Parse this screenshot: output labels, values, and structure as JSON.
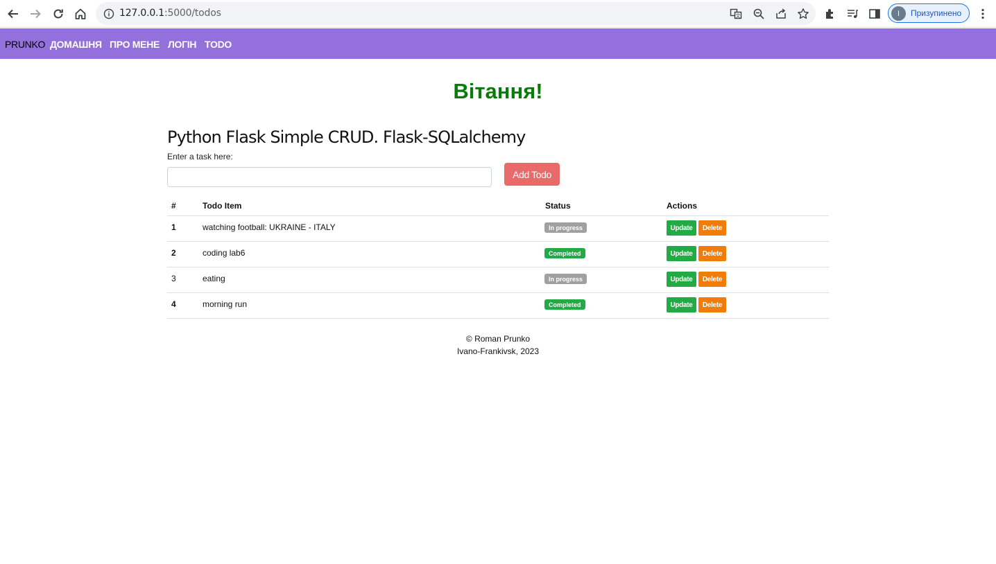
{
  "browser": {
    "url_host": "127.0.0.1",
    "url_path": ":5000/todos",
    "profile_initial": "I",
    "profile_label": "Призупинено"
  },
  "navbar": {
    "brand": "PRUNKO",
    "links": [
      "ДОМАШНЯ",
      "ПРО МЕНЕ",
      "ЛОГІН",
      "TODO"
    ],
    "bg_color": "#9370db"
  },
  "greeting": "Вітання!",
  "heading": "Python Flask Simple CRUD. Flask-SQLalchemy",
  "form": {
    "label": "Enter a task here:",
    "input_value": "",
    "add_button": "Add Todo"
  },
  "table": {
    "headers": [
      "#",
      "Todo Item",
      "Status",
      "Actions"
    ],
    "rows": [
      {
        "num": "1",
        "item": "watching football: UKRAINE - ITALY",
        "status": "In progress",
        "status_type": "progress"
      },
      {
        "num": "2",
        "item": "coding lab6",
        "status": "Completed",
        "status_type": "completed"
      },
      {
        "num": "3",
        "item": "eating",
        "status": "In progress",
        "status_type": "progress"
      },
      {
        "num": "4",
        "item": "morning run",
        "status": "Completed",
        "status_type": "completed"
      }
    ],
    "update_label": "Update",
    "delete_label": "Delete"
  },
  "footer": {
    "line1": "© Roman Prunko",
    "line2": "Ivano-Frankivsk, 2023"
  }
}
